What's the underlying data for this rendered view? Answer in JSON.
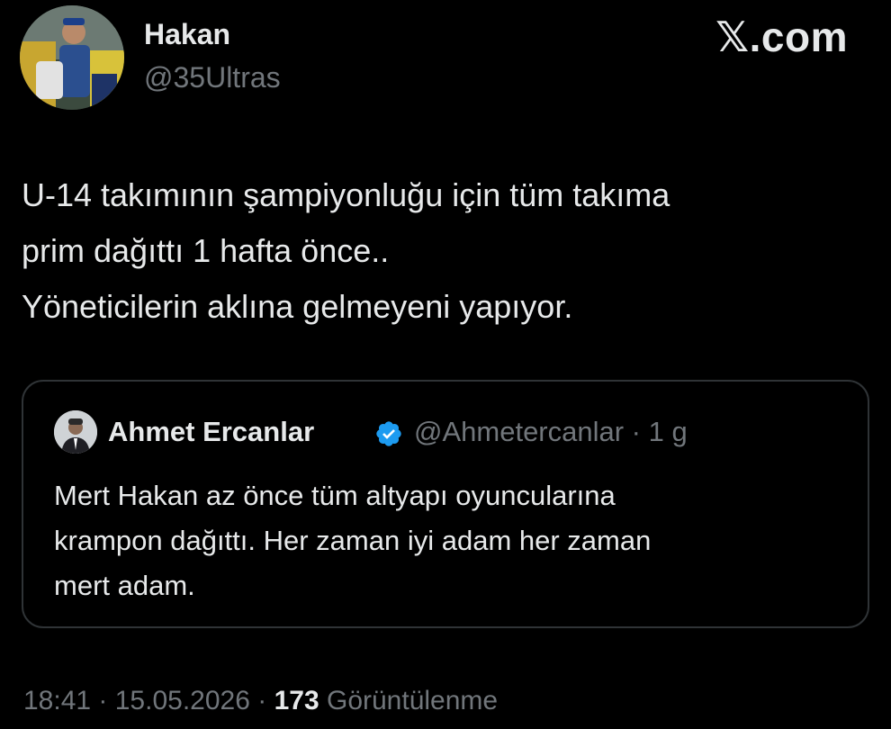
{
  "brand": "𝕏.com",
  "author": {
    "name": "Hakan",
    "handle": "@35Ultras"
  },
  "tweet": {
    "lines": [
      "U-14 takımının şampiyonluğu için tüm takıma",
      "prim dağıttı 1 hafta önce..",
      "Yöneticilerin aklına gelmeyeni yapıyor."
    ]
  },
  "quote": {
    "name": "Ahmet Ercanlar",
    "handle": "@Ahmetercanlar",
    "time": "1 g",
    "verified_color": "#1d9bf0",
    "lines": [
      "Mert Hakan az önce tüm altyapı oyuncularına",
      "krampon dağıttı. Her zaman iyi adam her zaman",
      "mert adam."
    ]
  },
  "meta": {
    "time": "18:41",
    "date": "15.05.2026",
    "views_count": "173",
    "views_label": "Görüntülenme"
  },
  "colors": {
    "background": "#000000",
    "text": "#e7e9ea",
    "muted": "#71767b",
    "border": "#2f3336"
  }
}
